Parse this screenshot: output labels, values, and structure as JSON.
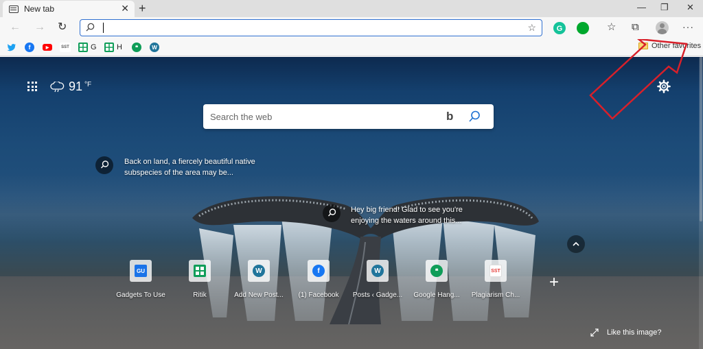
{
  "tab": {
    "title": "New tab"
  },
  "toolbar": {
    "address_value": ""
  },
  "favorites": {
    "items": [
      {
        "label": "",
        "icon": "twitter-icon",
        "color": "#1da1f2"
      },
      {
        "label": "",
        "icon": "facebook-icon",
        "color": "#1877f2"
      },
      {
        "label": "",
        "icon": "youtube-icon",
        "color": "#ff0000"
      },
      {
        "label": "",
        "icon": "sst-icon",
        "text": "SST",
        "color": "#ffffff"
      },
      {
        "label": "G",
        "icon": "google-sheets-icon",
        "color": "#0f9d58"
      },
      {
        "label": "H",
        "icon": "google-sheets-icon",
        "color": "#0f9d58"
      },
      {
        "label": "",
        "icon": "hangouts-icon",
        "color": "#0f9d58"
      },
      {
        "label": "",
        "icon": "wordpress-icon",
        "color": "#21759b"
      }
    ],
    "other": "Other favorites"
  },
  "ntp": {
    "weather": {
      "temp": "91",
      "unit": "°F"
    },
    "search": {
      "placeholder": "Search the web"
    },
    "hotspots": [
      {
        "text": "Back on land, a fiercely beautiful native subspecies of the area may be..."
      },
      {
        "text": "Hey big friend! Glad to see you're enjoying the waters around this..."
      }
    ],
    "tiles": [
      {
        "label": "Gadgets To Use",
        "icon": "gadgets-to-use-icon",
        "color": "#1a73e8"
      },
      {
        "label": "Ritik",
        "icon": "google-sheets-icon",
        "color": "#0f9d58"
      },
      {
        "label": "Add New Post...",
        "icon": "wordpress-icon",
        "color": "#21759b"
      },
      {
        "label": "(1) Facebook",
        "icon": "facebook-icon",
        "color": "#1877f2"
      },
      {
        "label": "Posts ‹ Gadge...",
        "icon": "wordpress-icon",
        "color": "#21759b"
      },
      {
        "label": "Google Hang...",
        "icon": "hangouts-icon",
        "color": "#0f9d58"
      },
      {
        "label": "Plagiarism Ch...",
        "icon": "sst-icon",
        "color": "#e53935"
      }
    ],
    "like_image": "Like this image?"
  },
  "colors": {
    "accent": "#2f6fd0",
    "annotation": "#d8202a"
  }
}
